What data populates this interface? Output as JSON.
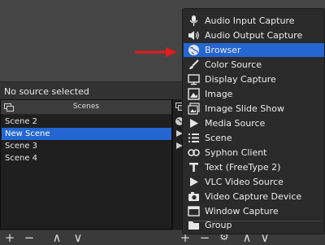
{
  "status": {
    "text": "No source selected"
  },
  "scenes": {
    "title": "Scenes",
    "items": [
      {
        "label": "Scene 2",
        "selected": false
      },
      {
        "label": "New Scene",
        "selected": true
      },
      {
        "label": "Scene 3",
        "selected": false
      },
      {
        "label": "Scene 4",
        "selected": false
      }
    ]
  },
  "toolbar": {
    "add": "+",
    "remove": "−",
    "up": "∧",
    "down": "∨",
    "settings": "⚙"
  },
  "add_source_menu": {
    "items": [
      {
        "label": "Audio Input Capture",
        "icon": "microphone-icon",
        "highlighted": false
      },
      {
        "label": "Audio Output Capture",
        "icon": "speaker-icon",
        "highlighted": false
      },
      {
        "label": "Browser",
        "icon": "globe-icon",
        "highlighted": true
      },
      {
        "label": "Color Source",
        "icon": "paint-brush-icon",
        "highlighted": false
      },
      {
        "label": "Display Capture",
        "icon": "monitor-icon",
        "highlighted": false
      },
      {
        "label": "Image",
        "icon": "image-icon",
        "highlighted": false
      },
      {
        "label": "Image Slide Show",
        "icon": "slideshow-icon",
        "highlighted": false
      },
      {
        "label": "Media Source",
        "icon": "play-icon",
        "highlighted": false
      },
      {
        "label": "Scene",
        "icon": "list-icon",
        "highlighted": false
      },
      {
        "label": "Syphon Client",
        "icon": "link-icon",
        "highlighted": false
      },
      {
        "label": "Text (FreeType 2)",
        "icon": "text-icon",
        "highlighted": false
      },
      {
        "label": "VLC Video Source",
        "icon": "play-icon",
        "highlighted": false
      },
      {
        "label": "Video Capture Device",
        "icon": "camera-icon",
        "highlighted": false
      },
      {
        "label": "Window Capture",
        "icon": "window-icon",
        "highlighted": false
      },
      {
        "label": "Group",
        "icon": "folder-icon",
        "highlighted": false
      }
    ]
  },
  "colors": {
    "accent": "#2466d2",
    "arrow": "#e21b1b",
    "panel": "#1f1f1f",
    "menu_bg": "#2a2a2a"
  }
}
